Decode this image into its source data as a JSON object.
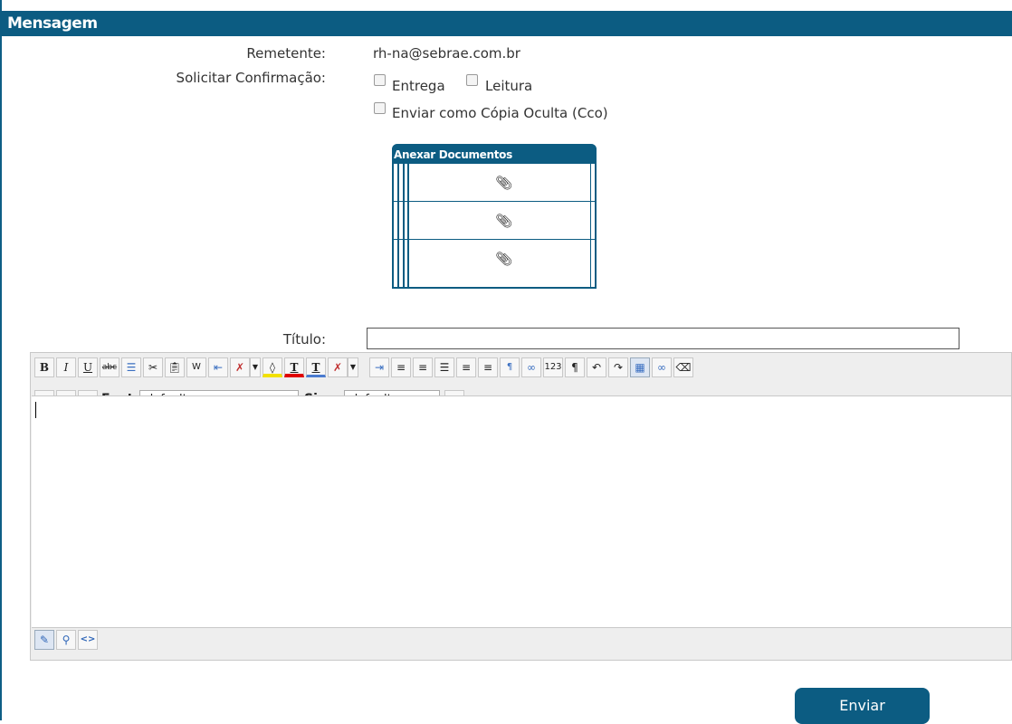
{
  "header": {
    "title": "Mensagem"
  },
  "form": {
    "remetente_label": "Remetente:",
    "remetente_value": "rh-na@sebrae.com.br",
    "confirmacao_label": "Solicitar Confirmação:",
    "entrega_label": "Entrega",
    "leitura_label": "Leitura",
    "cco_label": "Enviar como Cópia Oculta (Cco)",
    "titulo_label": "Título:",
    "titulo_value": ""
  },
  "anexar": {
    "title": "Anexar Documentos",
    "rows": [
      "attach-icon",
      "attach-icon",
      "attach-icon"
    ]
  },
  "editor": {
    "font_label": "Font",
    "font_value": "default",
    "size_label": "Size",
    "size_value": "default",
    "content": ""
  },
  "actions": {
    "enviar_label": "Enviar"
  },
  "colors": {
    "primary": "#0c5c82",
    "toolbar_bg": "#eeeeee"
  }
}
